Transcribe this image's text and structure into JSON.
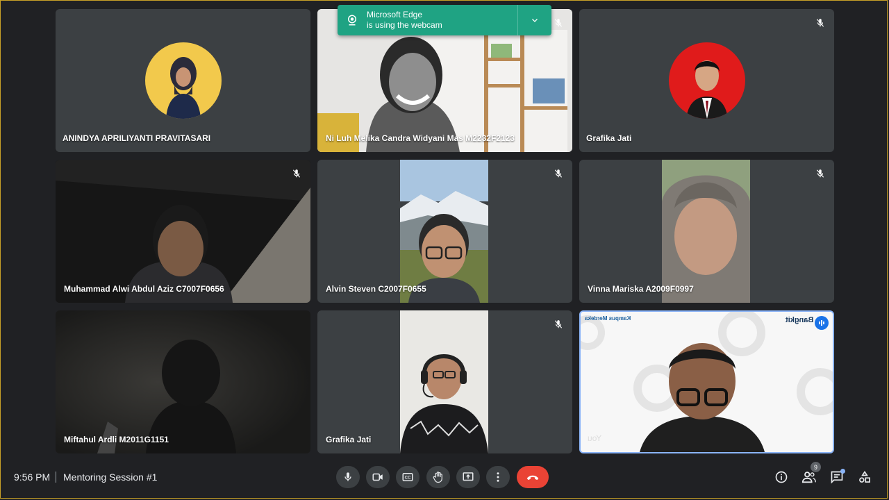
{
  "notification": {
    "app": "Microsoft Edge",
    "message": "is using the webcam"
  },
  "participants": [
    {
      "name": "ANINDYA APRILIYANTI PRAVITASARI",
      "muted": false,
      "type": "avatar"
    },
    {
      "name": "Ni Luh Melika Candra Widyani Mas M2232F2123",
      "muted": true,
      "type": "video"
    },
    {
      "name": "Grafika Jati",
      "muted": true,
      "type": "avatar"
    },
    {
      "name": "Muhammad Alwi Abdul Aziz C7007F0656",
      "muted": true,
      "type": "video"
    },
    {
      "name": "Alvin Steven C2007F0655",
      "muted": true,
      "type": "video"
    },
    {
      "name": "Vinna Mariska A2009F0997",
      "muted": true,
      "type": "video"
    },
    {
      "name": "Miftahul Ardli M2011G1151",
      "muted": false,
      "type": "video"
    },
    {
      "name": "Grafika Jati",
      "muted": true,
      "type": "video"
    },
    {
      "name": "You",
      "muted": false,
      "type": "video",
      "speaking": true
    }
  ],
  "self_tile": {
    "logo_left": "Kampus Merdeka",
    "logo_right": "Bangkit"
  },
  "bottom_bar": {
    "time": "9:56 PM",
    "meeting_title": "Mentoring Session #1",
    "people_count": "9"
  },
  "icons": {
    "mic": "mic-icon",
    "camera": "camera-icon",
    "captions": "captions-icon",
    "raise_hand": "raise-hand-icon",
    "present": "present-screen-icon",
    "more": "more-options-icon",
    "end_call": "end-call-icon",
    "info": "info-icon",
    "people": "people-icon",
    "chat": "chat-icon",
    "activities": "activities-icon"
  },
  "colors": {
    "background": "#202124",
    "tile": "#3c4043",
    "toast": "#1fa383",
    "end_call": "#ea4335",
    "active_speaker": "#8ab4f8"
  }
}
